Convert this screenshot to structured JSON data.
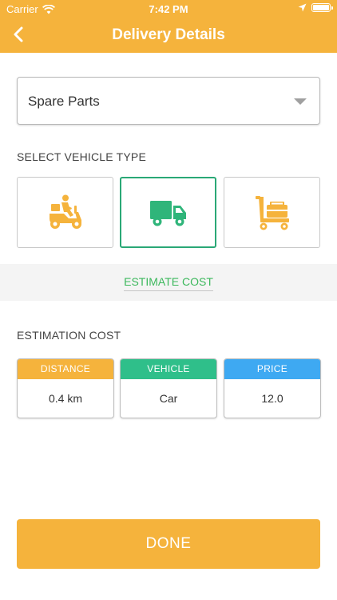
{
  "status_bar": {
    "carrier": "Carrier",
    "time": "7:42 PM"
  },
  "header": {
    "title": "Delivery Details",
    "back_icon": "chevron-left-icon"
  },
  "category": {
    "selected": "Spare Parts"
  },
  "vehicle_section": {
    "label": "SELECT VEHICLE TYPE",
    "options": [
      {
        "name": "scooter",
        "icon": "delivery-scooter-icon",
        "selected": false
      },
      {
        "name": "truck",
        "icon": "delivery-truck-icon",
        "selected": true
      },
      {
        "name": "trolley",
        "icon": "luggage-trolley-icon",
        "selected": false
      }
    ]
  },
  "estimate_link": "ESTIMATE COST",
  "estimation": {
    "label": "ESTIMATION COST",
    "cards": [
      {
        "header": "DISTANCE",
        "value": "0.4 km",
        "color": "#f5b33c"
      },
      {
        "header": "VEHICLE",
        "value": "Car",
        "color": "#2fbf8a"
      },
      {
        "header": "PRICE",
        "value": "12.0",
        "color": "#3ea9f2"
      }
    ]
  },
  "done_label": "DONE",
  "colors": {
    "primary": "#f5b33c",
    "selected_border": "#2aa876",
    "icon_orange": "#f5b33c",
    "icon_green": "#2fb57a"
  }
}
